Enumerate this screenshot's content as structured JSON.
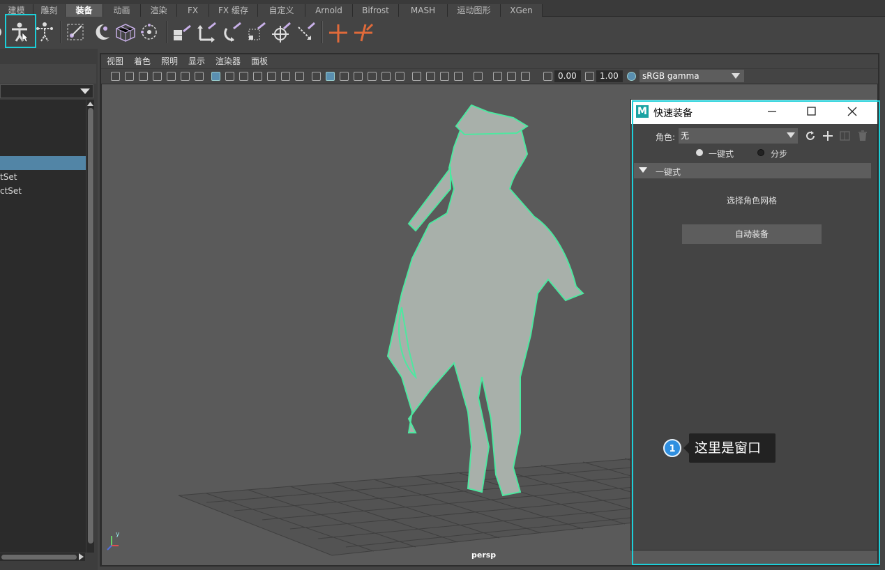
{
  "shelf_tabs": [
    "建模",
    "雕刻",
    "装备",
    "动画",
    "渲染",
    "FX",
    "FX 缓存",
    "自定义",
    "Arnold",
    "Bifrost",
    "MASH",
    "运动图形",
    "XGen"
  ],
  "active_shelf_tab": "装备",
  "outliner": {
    "items": [
      "",
      "tSet",
      "ctSet"
    ]
  },
  "viewport": {
    "menu": [
      "视图",
      "着色",
      "照明",
      "显示",
      "渲染器",
      "面板"
    ],
    "exposure": "0.00",
    "gamma": "1.00",
    "color_management": "sRGB gamma",
    "camera_label": "persp",
    "axis_label": "y"
  },
  "quick_rig": {
    "title": "快速装备",
    "logo_letter": "M",
    "character_label": "角色:",
    "character_value": "无",
    "radio_one_click": "一键式",
    "radio_step_by_step": "分步",
    "section_title": "一键式",
    "instruction": "选择角色网格",
    "auto_rig_button": "自动装备"
  },
  "tooltip": {
    "number": "1",
    "text": "这里是窗口"
  },
  "colors": {
    "highlight": "#1ccfd9",
    "wireframe": "#4de8a0",
    "selection": "#5285a6",
    "callout_badge": "#2f8fe0"
  }
}
